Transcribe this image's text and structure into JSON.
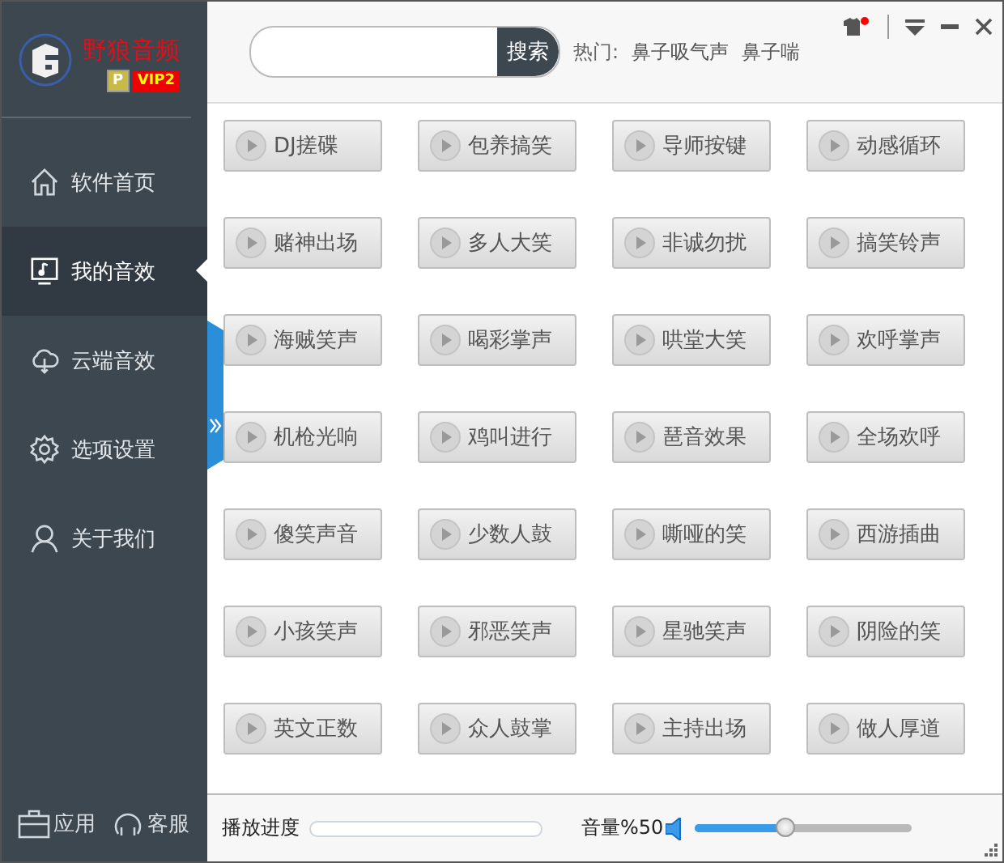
{
  "logo": {
    "title": "野狼音频",
    "badge_letter": "P",
    "badge": "VIP2"
  },
  "nav": [
    {
      "label": "软件首页",
      "selected": false
    },
    {
      "label": "我的音效",
      "selected": true
    },
    {
      "label": "云端音效",
      "selected": false
    },
    {
      "label": "选项设置",
      "selected": false
    },
    {
      "label": "关于我们",
      "selected": false
    }
  ],
  "sidebar_footer": [
    "应用",
    "客服"
  ],
  "search": {
    "button": "搜索",
    "hot_label": "热门:",
    "hot_terms": [
      "鼻子吸气声",
      "鼻子喘"
    ]
  },
  "header": {
    "skin_notification": true
  },
  "sounds": [
    "DJ搓碟",
    "包养搞笑",
    "导师按键",
    "动感循环",
    "赌神出场",
    "多人大笑",
    "非诚勿扰",
    "搞笑铃声",
    "海贼笑声",
    "喝彩掌声",
    "哄堂大笑",
    "欢呼掌声",
    "机枪光响",
    "鸡叫进行",
    "琶音效果",
    "全场欢呼",
    "傻笑声音",
    "少数人鼓",
    "嘶哑的笑",
    "西游插曲",
    "小孩笑声",
    "邪恶笑声",
    "星驰笑声",
    "阴险的笑",
    "英文正数",
    "众人鼓掌",
    "主持出场",
    "做人厚道"
  ],
  "player": {
    "progress_label": "播放进度",
    "progress": {
      "level": 0
    },
    "volume_label": "音量%50",
    "volume": {
      "level": 0.42
    }
  }
}
